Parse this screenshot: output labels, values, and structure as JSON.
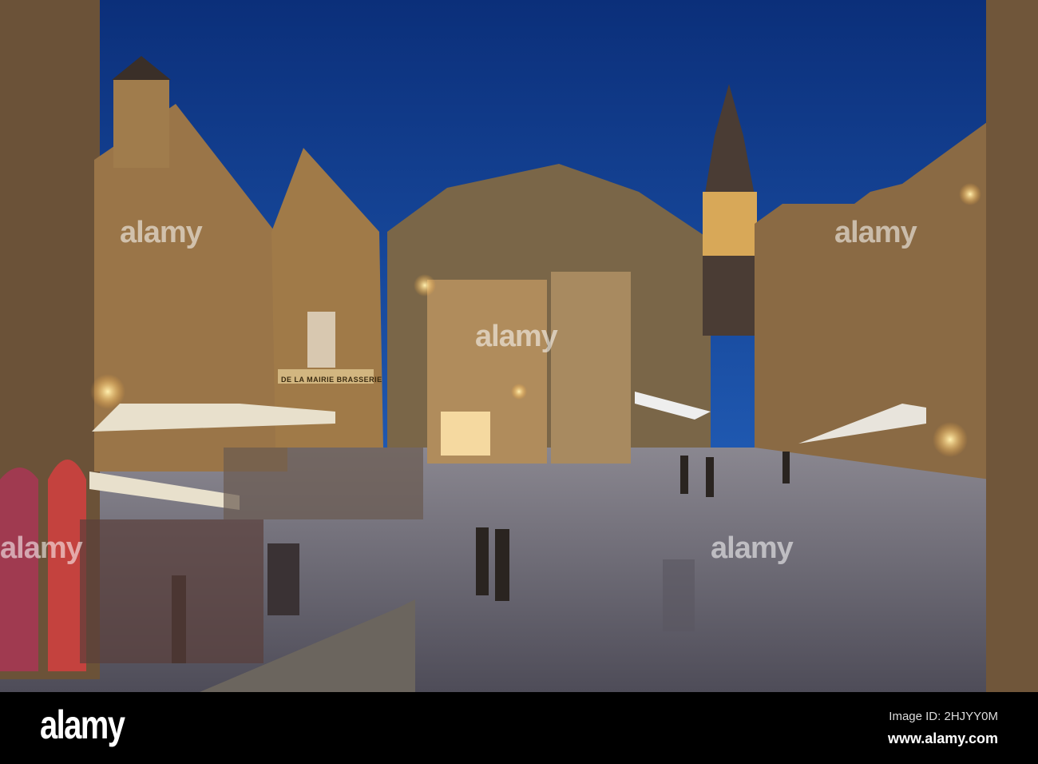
{
  "photo": {
    "subject": "town-square-at-dusk",
    "colors": {
      "sky": "#0f3a8c",
      "stone": "#8a6a40",
      "lamp": "#ffd27a",
      "pavement": "#6a6a78"
    }
  },
  "signage": {
    "brasserie": "DE LA MAIRIE BRASSERIE"
  },
  "watermark": {
    "text": "alamy"
  },
  "footer": {
    "logo": "alamy",
    "image_id": "Image ID: 2HJYY0M",
    "website": "www.alamy.com"
  }
}
